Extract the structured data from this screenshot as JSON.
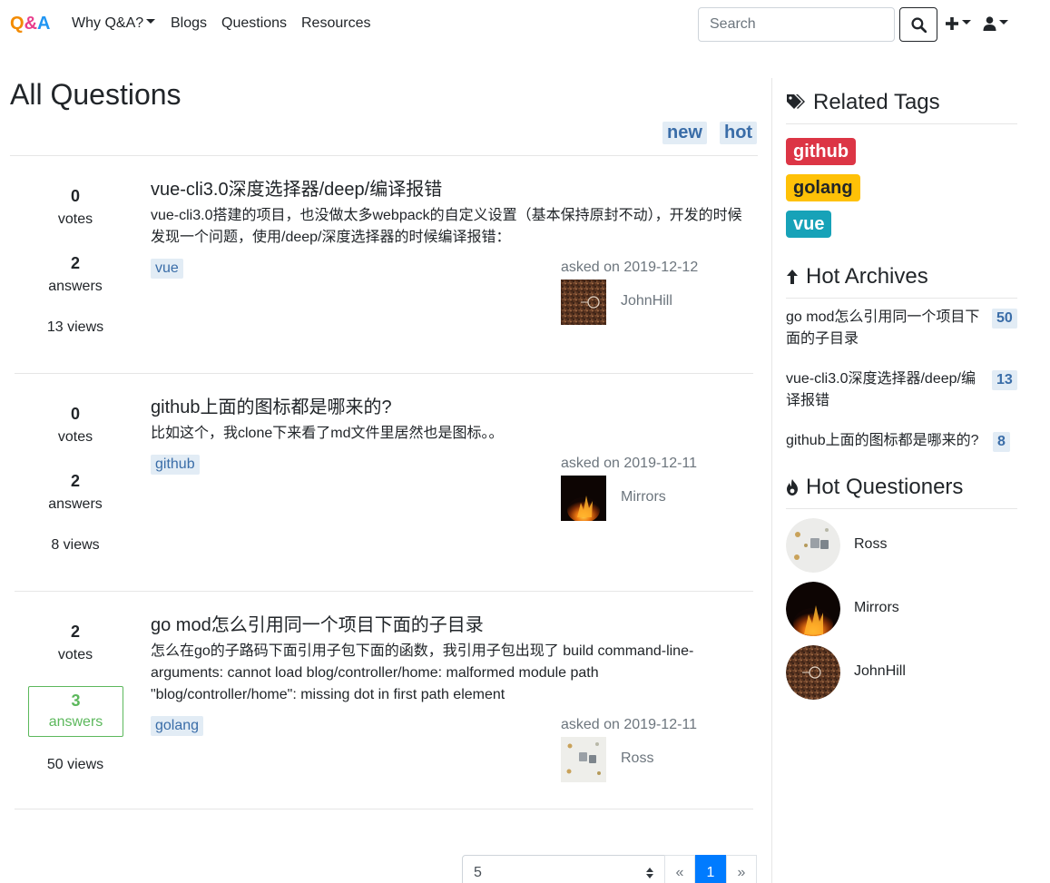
{
  "brand": {
    "q": "Q",
    "amp": "&",
    "a": "A"
  },
  "nav": {
    "why": "Why Q&A?",
    "blogs": "Blogs",
    "questions": "Questions",
    "resources": "Resources"
  },
  "search": {
    "placeholder": "Search",
    "value": ""
  },
  "main": {
    "title": "All Questions",
    "sort_tabs": [
      "new",
      "hot"
    ]
  },
  "questions": [
    {
      "votes": "0",
      "votes_label": "votes",
      "answers": "2",
      "answers_label": "answers",
      "views": "13 views",
      "title": "vue-cli3.0深度选择器/deep/编译报错",
      "excerpt": "vue-cli3.0搭建的项目，也没做太多webpack的自定义设置（基本保持原封不动），开发的时候发现一个问题，使用/deep/深度选择器的时候编译报错：",
      "tag": "vue",
      "asked": "asked on 2019-12-12",
      "author": "JohnHill",
      "accepted": false
    },
    {
      "votes": "0",
      "votes_label": "votes",
      "answers": "2",
      "answers_label": "answers",
      "views": "8 views",
      "title": "github上面的图标都是哪来的?",
      "excerpt": "比如这个，我clone下来看了md文件里居然也是图标。。",
      "tag": "github",
      "asked": "asked on 2019-12-11",
      "author": "Mirrors",
      "accepted": false
    },
    {
      "votes": "2",
      "votes_label": "votes",
      "answers": "3",
      "answers_label": "answers",
      "views": "50 views",
      "title": "go mod怎么引用同一个项目下面的子目录",
      "excerpt": "怎么在go的子路码下面引用子包下面的函数，我引用子包出现了 build command-line-arguments: cannot load blog/controller/home: malformed module path \"blog/controller/home\": missing dot in first path element",
      "tag": "golang",
      "asked": "asked on 2019-12-11",
      "author": "Ross",
      "accepted": true
    }
  ],
  "pagination": {
    "page_size": "5",
    "prev": "«",
    "current": "1",
    "next": "»"
  },
  "sidebar": {
    "related_tags_title": "Related Tags",
    "related_tags": [
      "github",
      "golang",
      "vue"
    ],
    "hot_archives_title": "Hot Archives",
    "hot_archives": [
      {
        "title": "go mod怎么引用同一个项目下面的子目录",
        "count": "50"
      },
      {
        "title": "vue-cli3.0深度选择器/deep/编译报错",
        "count": "13"
      },
      {
        "title": "github上面的图标都是哪来的?",
        "count": "8"
      }
    ],
    "hot_questioners_title": "Hot Questioners",
    "hot_questioners": [
      "Ross",
      "Mirrors",
      "JohnHill"
    ]
  },
  "colors": {
    "accent_blue": "#007bff",
    "tag_bg": "#e2ecf5",
    "tag_text": "#3a6da8",
    "accepted_green": "#5cb85c",
    "github_red": "#dc3545",
    "golang_yellow": "#ffc107",
    "vue_teal": "#17a2b8"
  },
  "icons": [
    "search-icon",
    "plus-icon",
    "user-icon",
    "tags-icon",
    "arrow-up-icon",
    "fire-icon",
    "chevron-updown-icon"
  ]
}
